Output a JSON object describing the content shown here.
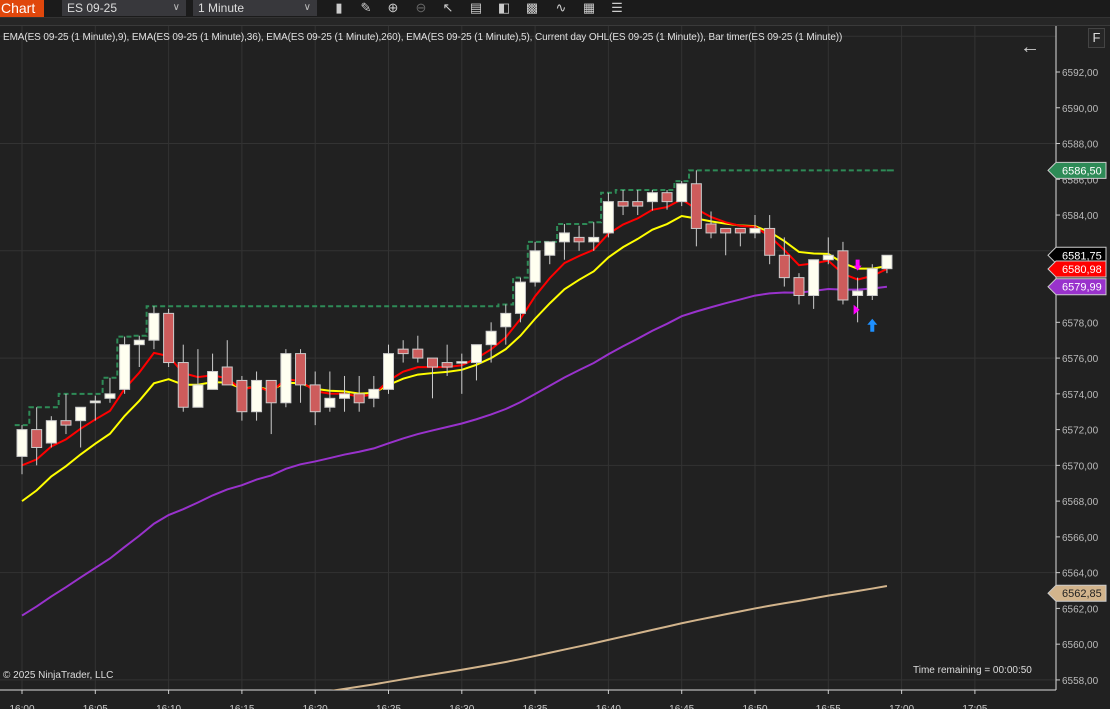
{
  "toolbar": {
    "tab": "Chart",
    "instrument": "ES 09-25",
    "interval": "1 Minute",
    "icons": [
      "bar-type-icon",
      "drawing-pencil-icon",
      "zoom-in-icon",
      "zoom-out-icon",
      "cursor-icon",
      "data-box-icon",
      "chart-trader-icon",
      "indicators-icon",
      "strategies-icon",
      "templates-icon",
      "properties-icon"
    ]
  },
  "legend": "EMA(ES 09-25 (1 Minute),9), EMA(ES 09-25 (1 Minute),36), EMA(ES 09-25 (1 Minute),260), EMA(ES 09-25 (1 Minute),5), Current day OHL(ES 09-25 (1 Minute)), Bar timer(ES 09-25 (1 Minute))",
  "f_button": "F",
  "copyright": "© 2025 NinjaTrader, LLC",
  "time_remaining": "Time remaining = 00:00:50",
  "chart_data": {
    "type": "candlestick",
    "ylim": [
      6557.5,
      6594.5
    ],
    "y_ticks": [
      "6558,00",
      "6560,00",
      "6562,00",
      "6564,00",
      "6566,00",
      "6568,00",
      "6570,00",
      "6572,00",
      "6574,00",
      "6576,00",
      "6578,00",
      "6580,00",
      "6582,00",
      "6584,00",
      "6586,00",
      "6588,00",
      "6590,00",
      "6592,00"
    ],
    "x_ticks": [
      "16:00",
      "16:05",
      "16:10",
      "16:15",
      "16:20",
      "16:25",
      "16:30",
      "16:35",
      "16:40",
      "16:45",
      "16:50",
      "16:55",
      "17:00",
      "17:05"
    ],
    "colors": {
      "up": "#fffff0",
      "down": "#cd5c5c",
      "wick": "#cccccc",
      "ohl": "#2e8b57",
      "bg": "#212121",
      "grid": "#333333"
    },
    "candles": [
      [
        6570.5,
        6572.25,
        6569.5,
        6572.0
      ],
      [
        6572.0,
        6573.25,
        6570.0,
        6571.0
      ],
      [
        6571.25,
        6572.75,
        6571.0,
        6572.5
      ],
      [
        6572.5,
        6574.0,
        6571.75,
        6572.25
      ],
      [
        6572.5,
        6573.25,
        6571.0,
        6573.25
      ],
      [
        6573.5,
        6573.9,
        6572.5,
        6573.6
      ],
      [
        6573.75,
        6574.9,
        6573.5,
        6574.0
      ],
      [
        6574.25,
        6577.2,
        6574.0,
        6576.75
      ],
      [
        6576.75,
        6577.25,
        6575.5,
        6577.0
      ],
      [
        6577.0,
        6578.9,
        6576.5,
        6578.5
      ],
      [
        6578.5,
        6578.75,
        6575.5,
        6575.75
      ],
      [
        6575.75,
        6576.75,
        6573.0,
        6573.25
      ],
      [
        6573.25,
        6576.5,
        6573.25,
        6574.5
      ],
      [
        6574.25,
        6576.25,
        6574.25,
        6575.25
      ],
      [
        6575.5,
        6577.0,
        6574.5,
        6574.5
      ],
      [
        6574.75,
        6575.0,
        6572.5,
        6573.0
      ],
      [
        6573.0,
        6575.25,
        6572.5,
        6574.75
      ],
      [
        6574.75,
        6574.75,
        6571.75,
        6573.5
      ],
      [
        6573.5,
        6576.5,
        6573.25,
        6576.25
      ],
      [
        6576.25,
        6576.5,
        6573.5,
        6574.5
      ],
      [
        6574.5,
        6575.25,
        6572.25,
        6573.0
      ],
      [
        6573.25,
        6575.25,
        6573.0,
        6573.75
      ],
      [
        6573.75,
        6575.0,
        6573.0,
        6574.0
      ],
      [
        6574.0,
        6575.0,
        6573.0,
        6573.5
      ],
      [
        6573.75,
        6575.0,
        6573.25,
        6574.25
      ],
      [
        6574.25,
        6576.75,
        6574.0,
        6576.25
      ],
      [
        6576.5,
        6577.0,
        6575.75,
        6576.25
      ],
      [
        6576.5,
        6577.25,
        6575.75,
        6576.0
      ],
      [
        6576.0,
        6576.0,
        6573.75,
        6575.5
      ],
      [
        6575.75,
        6576.75,
        6575.0,
        6575.5
      ],
      [
        6575.75,
        6576.25,
        6574.0,
        6575.8
      ],
      [
        6575.75,
        6576.75,
        6574.75,
        6576.75
      ],
      [
        6576.75,
        6578.0,
        6575.75,
        6577.5
      ],
      [
        6577.75,
        6579.0,
        6576.75,
        6578.5
      ],
      [
        6578.5,
        6580.5,
        6578.0,
        6580.25
      ],
      [
        6580.25,
        6582.5,
        6580.0,
        6582.0
      ],
      [
        6581.75,
        6582.5,
        6581.25,
        6582.5
      ],
      [
        6582.5,
        6583.5,
        6581.5,
        6583.0
      ],
      [
        6582.75,
        6583.4,
        6582.0,
        6582.5
      ],
      [
        6582.5,
        6583.6,
        6582.0,
        6582.75
      ],
      [
        6583.0,
        6585.25,
        6582.75,
        6584.75
      ],
      [
        6584.75,
        6585.4,
        6584.0,
        6584.5
      ],
      [
        6584.75,
        6585.4,
        6584.0,
        6584.5
      ],
      [
        6584.75,
        6585.4,
        6584.25,
        6585.25
      ],
      [
        6585.25,
        6585.4,
        6584.3,
        6584.75
      ],
      [
        6584.75,
        6585.9,
        6584.5,
        6585.75
      ],
      [
        6585.75,
        6586.5,
        6582.25,
        6583.25
      ],
      [
        6583.5,
        6584.2,
        6582.7,
        6583.0
      ],
      [
        6583.25,
        6583.25,
        6581.75,
        6583.0
      ],
      [
        6583.25,
        6583.25,
        6582.25,
        6583.0
      ],
      [
        6583.0,
        6584.0,
        6582.7,
        6583.25
      ],
      [
        6583.25,
        6584.0,
        6581.25,
        6581.75
      ],
      [
        6581.75,
        6582.75,
        6580.0,
        6580.5
      ],
      [
        6580.5,
        6580.75,
        6579.0,
        6579.5
      ],
      [
        6579.5,
        6581.5,
        6578.75,
        6581.5
      ],
      [
        6581.5,
        6582.75,
        6581.25,
        6581.75
      ],
      [
        6582.0,
        6582.5,
        6579.0,
        6579.25
      ],
      [
        6579.5,
        6580.5,
        6578.0,
        6579.75
      ],
      [
        6579.5,
        6581.25,
        6579.25,
        6581.0
      ],
      [
        6581.0,
        6581.75,
        6580.75,
        6581.75
      ]
    ],
    "ema_series": [
      {
        "name": "EMA 260",
        "period": 260,
        "seed": 6554.4,
        "color": "#d2b48c"
      },
      {
        "name": "EMA 36",
        "period": 36,
        "seed": 6561.6,
        "color": "#9932cc"
      },
      {
        "name": "EMA 9",
        "period": 9,
        "seed": 6568.0,
        "color": "#ffff00"
      },
      {
        "name": "EMA 5",
        "period": 5,
        "seed": 6570.0,
        "color": "#ff0000"
      }
    ],
    "price_flags": [
      {
        "value": 6586.5,
        "label": "6586,50",
        "bg": "#2e8b57",
        "fg": "#ffffff"
      },
      {
        "value": 6581.75,
        "label": "6581,75",
        "bg": "#000000",
        "fg": "#ffffff"
      },
      {
        "value": 6580.98,
        "label": "6580,98",
        "bg": "#ff0000",
        "fg": "#ffffff"
      },
      {
        "value": 6579.99,
        "label": "6579,99",
        "bg": "#9932cc",
        "fg": "#ffffff"
      },
      {
        "value": 6562.85,
        "label": "6562,85",
        "bg": "#d2b48c",
        "fg": "#222222"
      }
    ],
    "signals": [
      {
        "bar": 57,
        "type": "down-arrow",
        "price": 6581.0,
        "color": "#ff00ff"
      },
      {
        "bar": 57,
        "type": "right-triangle",
        "price": 6578.7,
        "color": "#ff00ff"
      },
      {
        "bar": 58,
        "type": "up-arrow",
        "price": 6578.2,
        "color": "#1e90ff"
      }
    ]
  }
}
